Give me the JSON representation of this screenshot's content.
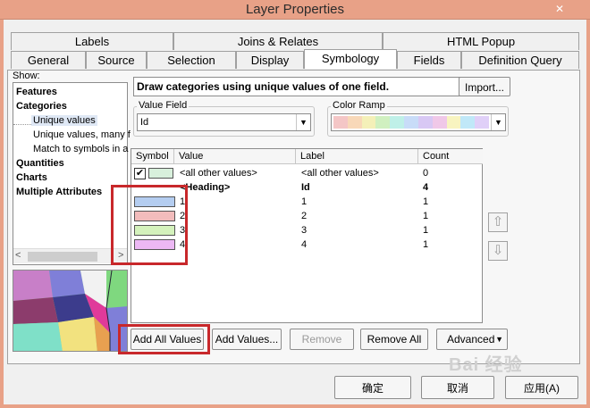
{
  "window": {
    "title": "Layer Properties",
    "close_glyph": "✕"
  },
  "tabs_row1": [
    {
      "label": "Labels"
    },
    {
      "label": "Joins & Relates"
    },
    {
      "label": "HTML Popup"
    }
  ],
  "tabs_row2": [
    {
      "label": "General"
    },
    {
      "label": "Source"
    },
    {
      "label": "Selection"
    },
    {
      "label": "Display"
    },
    {
      "label": "Symbology",
      "active": true
    },
    {
      "label": "Fields"
    },
    {
      "label": "Definition Query"
    }
  ],
  "show": {
    "label": "Show:",
    "items": [
      {
        "label": "Features",
        "bold": true
      },
      {
        "label": "Categories",
        "bold": true
      },
      {
        "label": "Unique values",
        "selected": true
      },
      {
        "label": "Unique values, many f"
      },
      {
        "label": "Match to symbols in a"
      },
      {
        "label": "Quantities",
        "bold": true
      },
      {
        "label": "Charts",
        "bold": true
      },
      {
        "label": "Multiple Attributes",
        "bold": true
      }
    ]
  },
  "description": "Draw categories using unique values of one field.",
  "import_label": "Import...",
  "value_field": {
    "label": "Value Field",
    "value": "Id"
  },
  "color_ramp": {
    "label": "Color Ramp",
    "colors": [
      "#f4c6c6",
      "#f8d8b8",
      "#f4f0b8",
      "#d0f0c0",
      "#bff0e8",
      "#c8dcf8",
      "#d8c8f4",
      "#f0c8e8",
      "#f8f4c0",
      "#c0e8f8",
      "#e0d0f8"
    ]
  },
  "table": {
    "headers": [
      "Symbol",
      "Value",
      "Label",
      "Count"
    ],
    "rows": [
      {
        "value": "<all other values>",
        "label": "<all other values>",
        "count": "0",
        "color": "#d8f0dc",
        "checked": true
      },
      {
        "value": "<Heading>",
        "label": "Id",
        "count": "4",
        "heading": true
      },
      {
        "value": "1",
        "label": "1",
        "count": "1",
        "color": "#b4cdf0"
      },
      {
        "value": "2",
        "label": "2",
        "count": "1",
        "color": "#f2bcbc"
      },
      {
        "value": "3",
        "label": "3",
        "count": "1",
        "color": "#d4f2bc"
      },
      {
        "value": "4",
        "label": "4",
        "count": "1",
        "color": "#ecb8f4"
      }
    ]
  },
  "buttons": {
    "add_all": "Add All Values",
    "add_values": "Add Values...",
    "remove": "Remove",
    "remove_all": "Remove All",
    "advanced": "Advanced",
    "ok": "确定",
    "cancel": "取消",
    "apply": "应用(A)"
  },
  "watermark": "Bai 经验"
}
